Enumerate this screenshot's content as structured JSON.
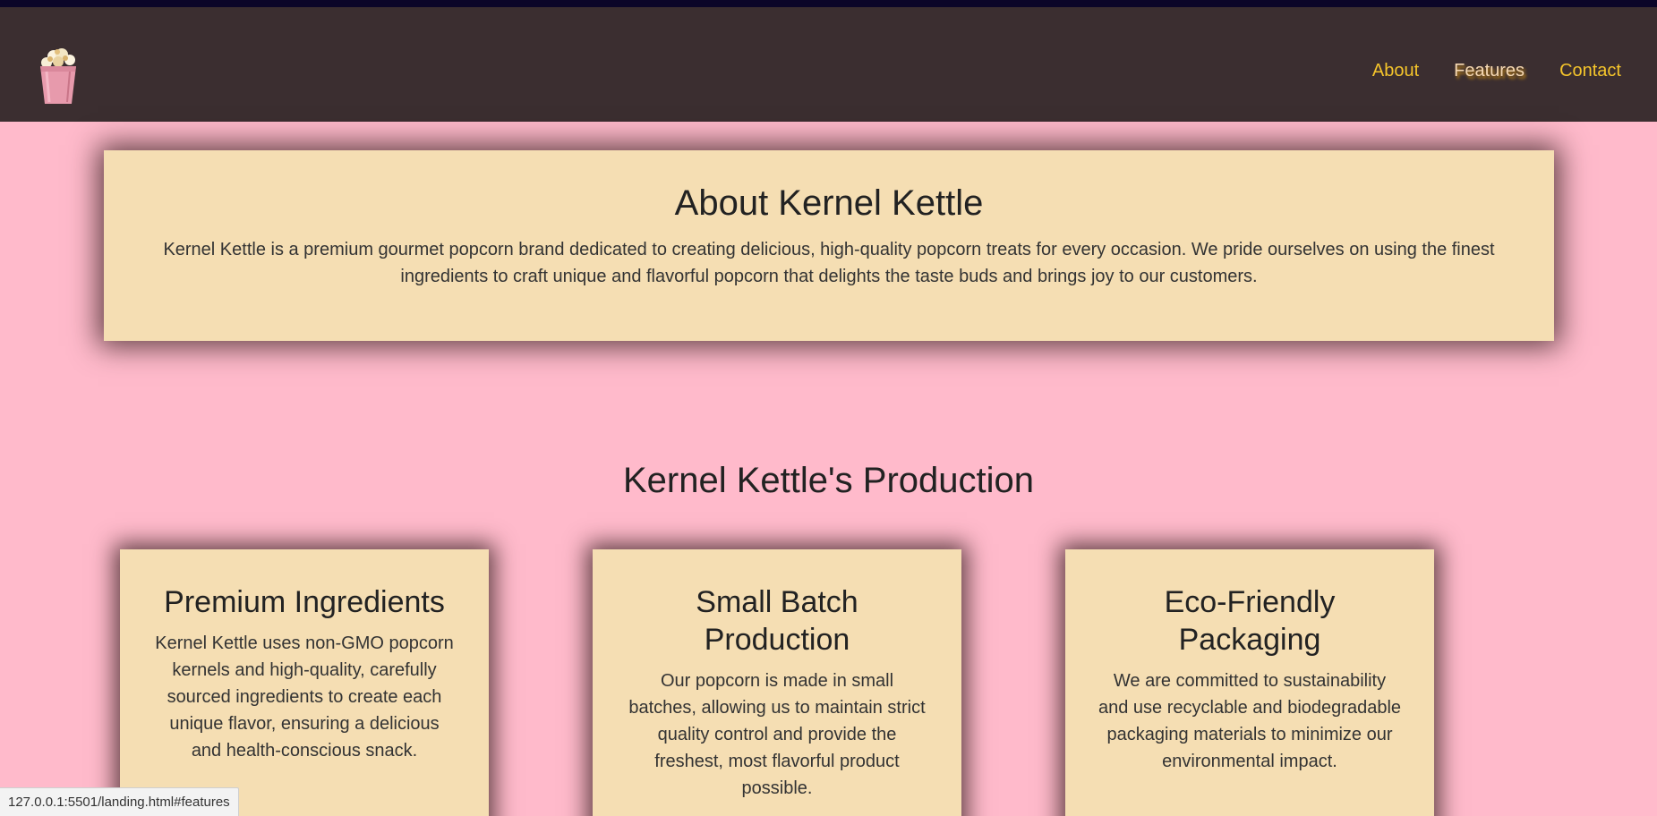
{
  "nav": {
    "links": [
      {
        "label": "About",
        "active": false
      },
      {
        "label": "Features",
        "active": true
      },
      {
        "label": "Contact",
        "active": false
      }
    ],
    "logo_icon": "popcorn-bucket-icon"
  },
  "about": {
    "title": "About Kernel Kettle",
    "text": "Kernel Kettle is a premium gourmet popcorn brand dedicated to creating delicious, high-quality popcorn treats for every occasion. We pride ourselves on using the finest ingredients to craft unique and flavorful popcorn that delights the taste buds and brings joy to our customers."
  },
  "production": {
    "title": "Kernel Kettle's Production",
    "features": [
      {
        "title": "Premium Ingredients",
        "text": "Kernel Kettle uses non-GMO popcorn kernels and high-quality, carefully sourced ingredients to create each unique flavor, ensuring a delicious and health-conscious snack."
      },
      {
        "title": "Small Batch Production",
        "text": "Our popcorn is made in small batches, allowing us to maintain strict quality control and provide the freshest, most flavorful product possible."
      },
      {
        "title": "Eco-Friendly Packaging",
        "text": "We are committed to sustainability and use recyclable and biodegradable packaging materials to minimize our environmental impact."
      }
    ]
  },
  "status_bar": {
    "url": "127.0.0.1:5501/landing.html#features"
  },
  "colors": {
    "page_background": "#ffbacb",
    "navbar_background": "#3b2e30",
    "card_background": "#f5deb3",
    "nav_link": "#f5c52b"
  }
}
